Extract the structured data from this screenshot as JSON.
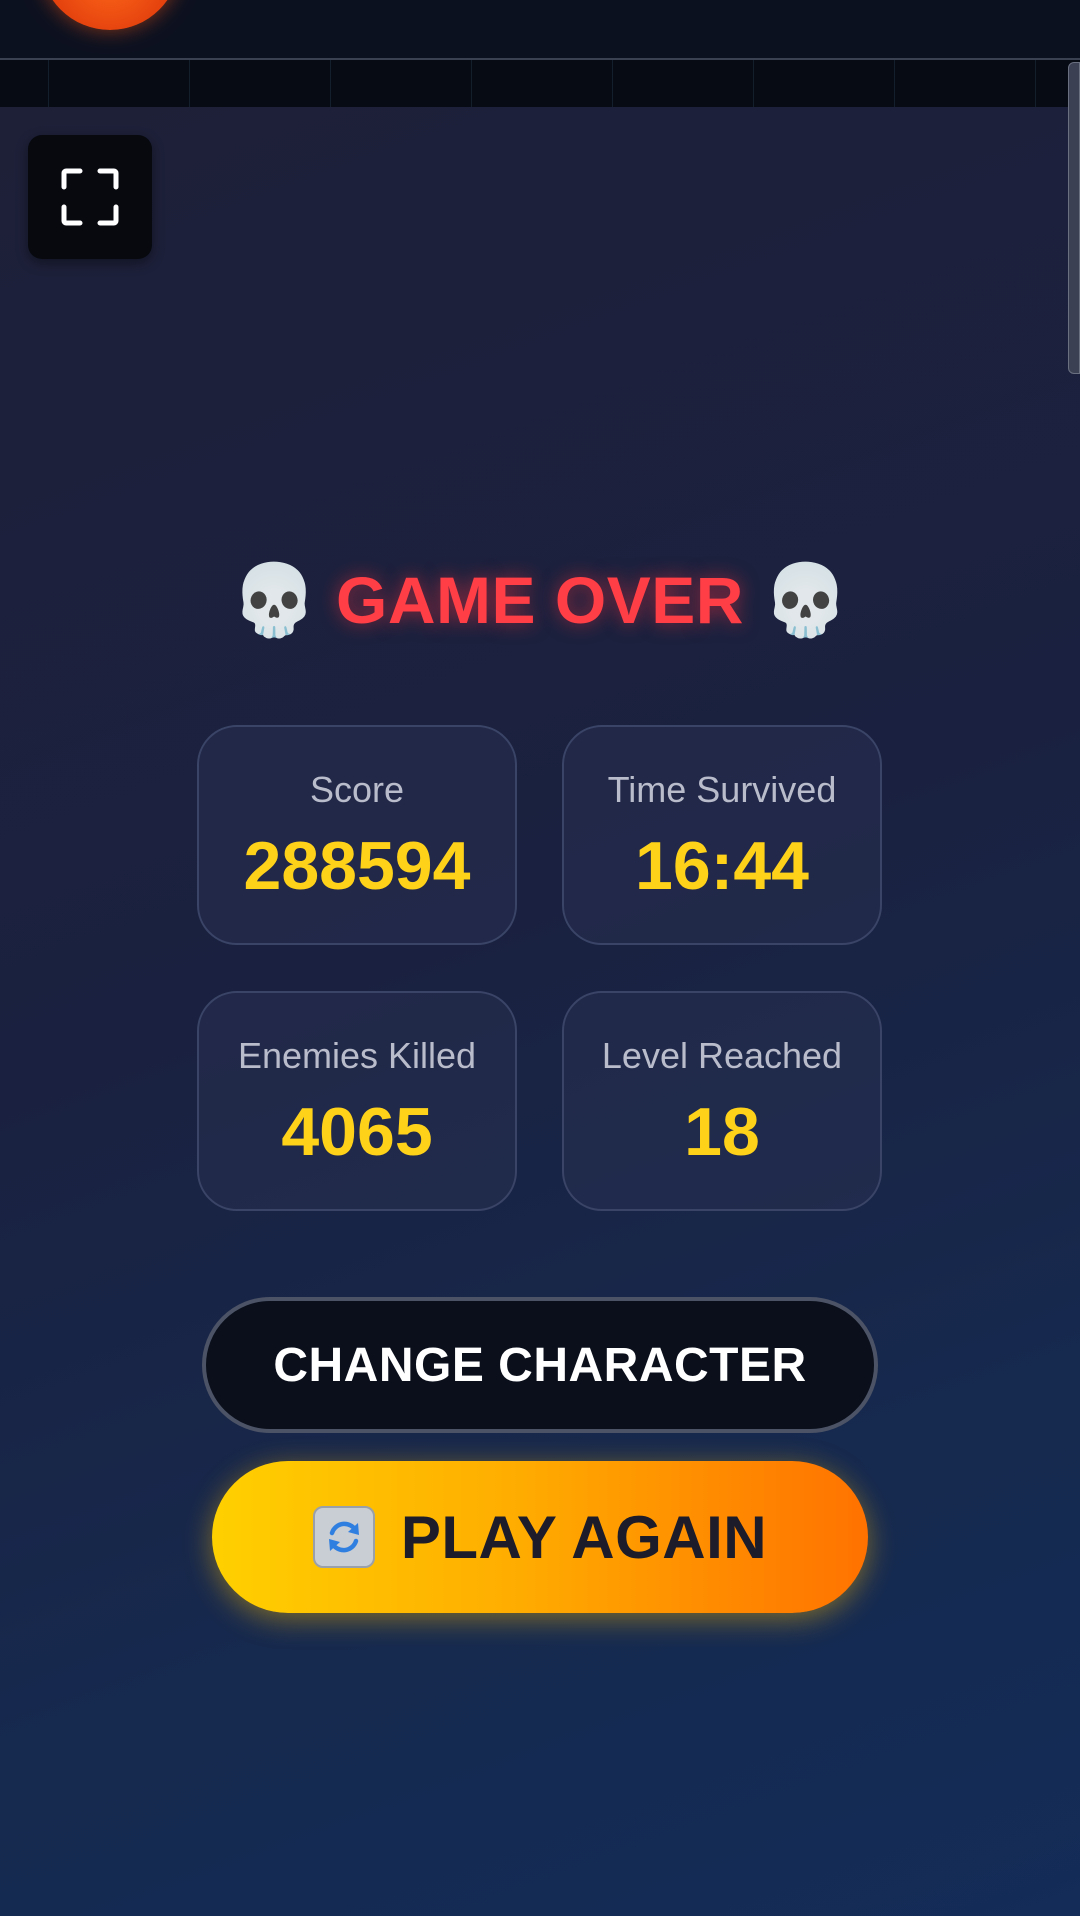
{
  "title": {
    "left_icon": "skull-icon",
    "text": "GAME OVER",
    "right_icon": "skull-icon",
    "skull_glyph": "💀"
  },
  "stats": [
    {
      "label": "Score",
      "value": "288594"
    },
    {
      "label": "Time Survived",
      "value": "16:44"
    },
    {
      "label": "Enemies Killed",
      "value": "4065"
    },
    {
      "label": "Level Reached",
      "value": "18"
    }
  ],
  "buttons": {
    "change_character": "CHANGE CHARACTER",
    "play_again": "PLAY AGAIN",
    "play_again_icon": "refresh-icon",
    "fullscreen_icon": "fullscreen-icon"
  },
  "colors": {
    "title": "#ff3e45",
    "stat_value": "#ffd21a",
    "play_gradient_start": "#ffd000",
    "play_gradient_end": "#ff7200"
  }
}
